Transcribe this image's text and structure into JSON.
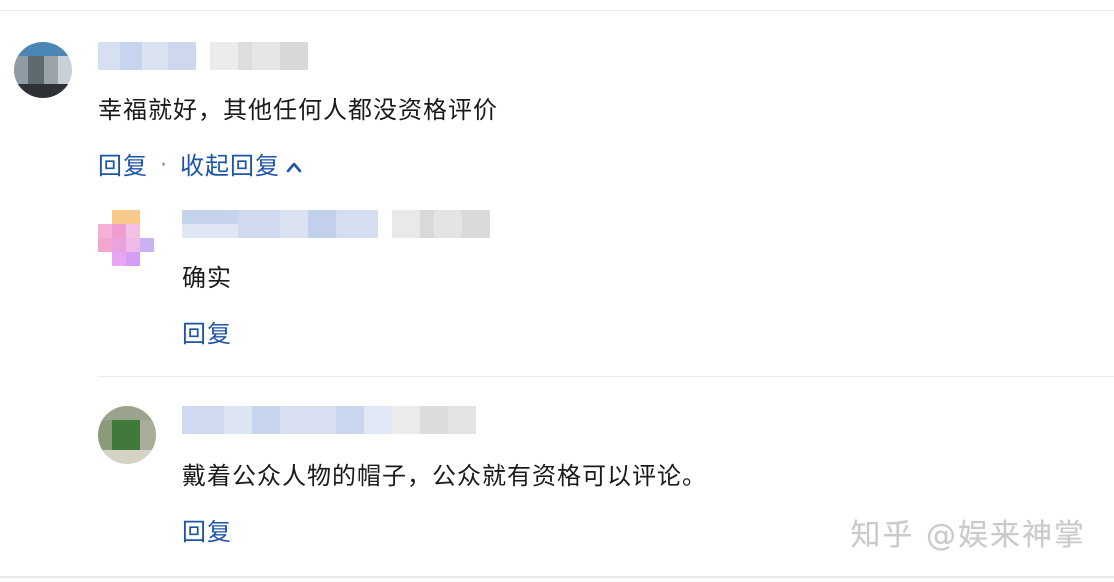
{
  "comments": [
    {
      "text": "幸福就好，其他任何人都没资格评价",
      "actions": {
        "reply": "回复",
        "separator": "·",
        "collapse": "收起回复"
      }
    },
    {
      "text": "确实",
      "actions": {
        "reply": "回复"
      }
    },
    {
      "text": "戴着公众人物的帽子，公众就有资格可以评论。",
      "actions": {
        "reply": "回复"
      }
    }
  ],
  "icons": {
    "collapse": "chevron-up-icon"
  },
  "colors": {
    "link": "#1e54a6",
    "text": "#1a1a1a",
    "divider": "#ececec"
  },
  "watermark": "知乎 @娱来神掌"
}
